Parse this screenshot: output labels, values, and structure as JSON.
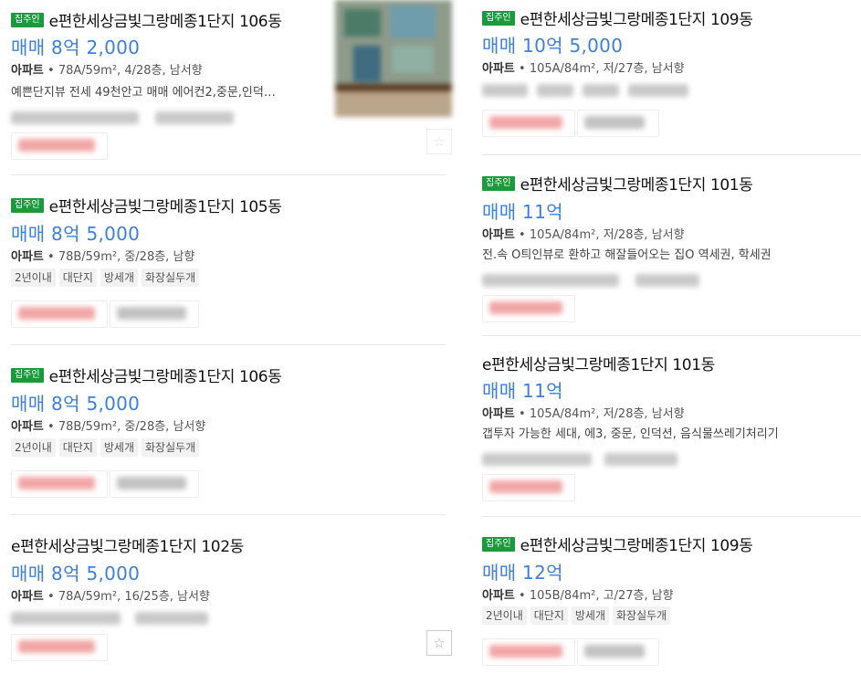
{
  "listings": {
    "l1": {
      "badge": "집주인",
      "title": "e편한세상금빛그랑메종1단지 106동",
      "price": "매매 8억 2,000",
      "type": "아파트",
      "spec": " • 78A/59m², 4/28층, 남서향",
      "desc": "예쁜단지뷰 전세 49천안고 매매 에어컨2,중문,인덕…"
    },
    "l2": {
      "badge": "집주인",
      "title": "e편한세상금빛그랑메종1단지 105동",
      "price": "매매 8억 5,000",
      "type": "아파트",
      "spec": " • 78B/59m², 중/28층, 남향",
      "tags": [
        "2년이내",
        "대단지",
        "방세개",
        "화장실두개"
      ]
    },
    "l3": {
      "badge": "집주인",
      "title": "e편한세상금빛그랑메종1단지 106동",
      "price": "매매 8억 5,000",
      "type": "아파트",
      "spec": " • 78B/59m², 중/28층, 남서향",
      "tags": [
        "2년이내",
        "대단지",
        "방세개",
        "화장실두개"
      ]
    },
    "l4": {
      "title": "e편한세상금빛그랑메종1단지 102동",
      "price": "매매 8억 5,000",
      "type": "아파트",
      "spec": " • 78A/59m², 16/25층, 남서향"
    },
    "r1": {
      "badge": "집주인",
      "title": "e편한세상금빛그랑메종1단지 109동",
      "price": "매매 10억 5,000",
      "type": "아파트",
      "spec": " • 105A/84m², 저/27층, 남서향"
    },
    "r2": {
      "badge": "집주인",
      "title": "e편한세상금빛그랑메종1단지 101동",
      "price": "매매 11억",
      "type": "아파트",
      "spec": " • 105A/84m², 저/28층, 남서향",
      "desc": "전.속 O틔인뷰로 환하고 해잘들어오는 집O 역세권, 학세권"
    },
    "r3": {
      "title": "e편한세상금빛그랑메종1단지 101동",
      "price": "매매 11억",
      "type": "아파트",
      "spec": " • 105A/84m², 저/28층, 남서향",
      "desc": "갭투자 가능한 세대, 에3, 중문, 인덕션, 음식물쓰레기처리기"
    },
    "r4": {
      "badge": "집주인",
      "title": "e편한세상금빛그랑메종1단지 109동",
      "price": "매매 12억",
      "type": "아파트",
      "spec": " • 105B/84m², 고/27층, 남향",
      "tags": [
        "2년이내",
        "대단지",
        "방세개",
        "화장실두개"
      ]
    }
  },
  "icons": {
    "favorite": "☆"
  },
  "colors": {
    "badge": "#1a9a3c",
    "price": "#3c7fe0"
  }
}
